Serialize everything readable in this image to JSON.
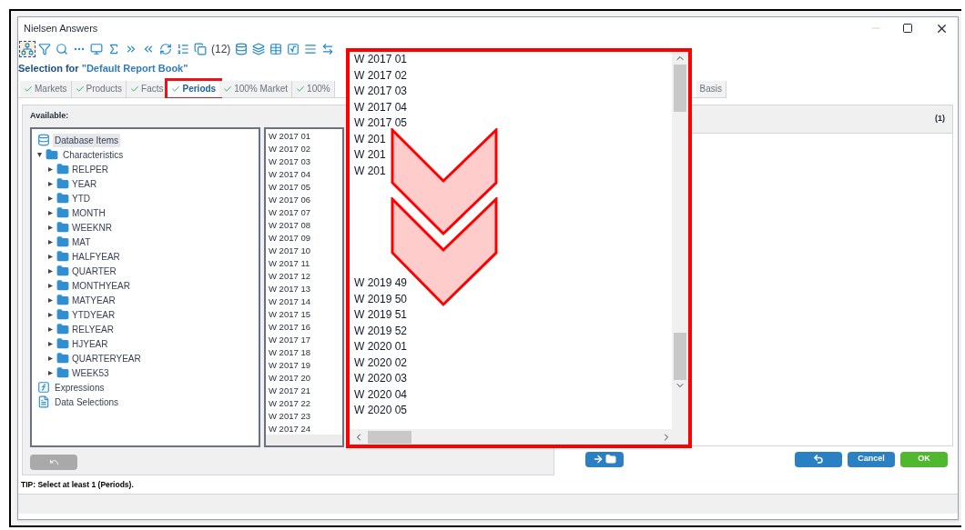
{
  "window": {
    "title": "Nielsen Answers"
  },
  "toolbar": {
    "tools": [
      {
        "kind": "hierarchy",
        "selected": true
      },
      {
        "kind": "filter",
        "selected": false
      },
      {
        "kind": "search",
        "selected": false
      },
      {
        "kind": "dots",
        "selected": false
      },
      {
        "kind": "monitor",
        "selected": false
      },
      {
        "kind": "sigma",
        "selected": false
      },
      {
        "kind": "arrows",
        "selected": false
      },
      {
        "kind": "back",
        "selected": false
      },
      {
        "kind": "refresh",
        "selected": false
      },
      {
        "kind": "sort",
        "selected": false
      },
      {
        "kind": "copy",
        "selected": false
      },
      {
        "kind": "counter",
        "label": "(12)",
        "selected": false
      },
      {
        "kind": "database",
        "selected": false
      },
      {
        "kind": "layers",
        "selected": false
      },
      {
        "kind": "table",
        "selected": false
      },
      {
        "kind": "radical",
        "selected": false
      },
      {
        "kind": "list",
        "selected": false
      },
      {
        "kind": "swap",
        "selected": false
      }
    ]
  },
  "heading": {
    "prefix": "Selection for ",
    "name": "\"Default Report Book\""
  },
  "tabs": [
    {
      "label": "Markets",
      "selected": false,
      "highlighted": false
    },
    {
      "label": "Products",
      "selected": false,
      "highlighted": false
    },
    {
      "label": "Facts",
      "selected": false,
      "highlighted": false
    },
    {
      "label": "Periods",
      "selected": true,
      "highlighted": true
    },
    {
      "label": "100% Market",
      "selected": false,
      "highlighted": false
    },
    {
      "label": "100%",
      "selected": false,
      "highlighted": false
    },
    {
      "label": "Basis",
      "selected": false,
      "highlighted": false
    }
  ],
  "available": {
    "label": "Available:",
    "tree": [
      {
        "label": "Database Items",
        "kind": "database",
        "selected": true
      },
      {
        "label": "Characteristics",
        "kind": "group",
        "selected": false,
        "expanded": true,
        "children": [
          {
            "label": "RELPER",
            "expanded": false
          },
          {
            "label": "YEAR",
            "expanded": false
          },
          {
            "label": "YTD",
            "expanded": false
          },
          {
            "label": "MONTH",
            "expanded": false
          },
          {
            "label": "WEEKNR",
            "expanded": false
          },
          {
            "label": "MAT",
            "expanded": false
          },
          {
            "label": "HALFYEAR",
            "expanded": false
          },
          {
            "label": "QUARTER",
            "expanded": false
          },
          {
            "label": "MONTHYEAR",
            "expanded": false
          },
          {
            "label": "MATYEAR",
            "expanded": false
          },
          {
            "label": "YTDYEAR",
            "expanded": false
          },
          {
            "label": "RELYEAR",
            "expanded": false
          },
          {
            "label": "HJYEAR",
            "expanded": false
          },
          {
            "label": "QUARTERYEAR",
            "expanded": false
          },
          {
            "label": "WEEK53",
            "expanded": false
          }
        ]
      },
      {
        "label": "Expressions",
        "kind": "expressions",
        "selected": false
      },
      {
        "label": "Data Selections",
        "kind": "selections",
        "selected": false
      }
    ],
    "periods": [
      "W 2017 01",
      "W 2017 02",
      "W 2017 03",
      "W 2017 04",
      "W 2017 05",
      "W 2017 06",
      "W 2017 07",
      "W 2017 08",
      "W 2017 09",
      "W 2017 10",
      "W 2017 11",
      "W 2017 12",
      "W 2017 13",
      "W 2017 14",
      "W 2017 15",
      "W 2017 16",
      "W 2017 17",
      "W 2017 18",
      "W 2017 19",
      "W 2017 20",
      "W 2017 21",
      "W 2017 22",
      "W 2017 23",
      "W 2017 24"
    ]
  },
  "selected_panel": {
    "count": "(1)"
  },
  "tip": "TIP: Select at least 1 (Periods).",
  "zoom_inset": {
    "top_items": [
      "W 2017 01",
      "W 2017 02",
      "W 2017 03",
      "W 2017 04",
      "W 2017 05",
      "W 201",
      "W 201",
      "W 201"
    ],
    "bottom_items": [
      "W 2019 49",
      "W 2019 50",
      "W 2019 51",
      "W 2019 52",
      "W 2020 01",
      "W 2020 02",
      "W 2020 03",
      "W 2020 04",
      "W 2020 05"
    ]
  },
  "buttons": [
    {
      "kind": "move"
    },
    {
      "kind": "undo"
    },
    {
      "kind": "cancel",
      "label": "Cancel"
    },
    {
      "kind": "ok",
      "label": "OK"
    }
  ],
  "restore_button": {
    "disabled": true
  }
}
